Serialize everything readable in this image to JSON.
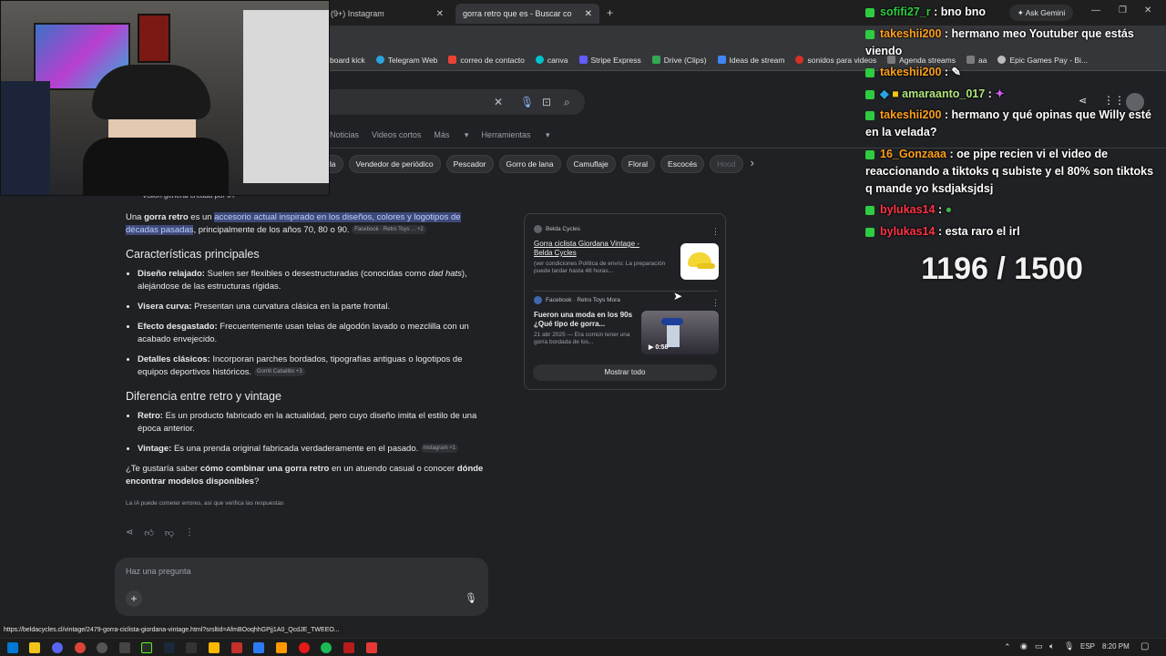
{
  "browser": {
    "tabs": [
      {
        "label": "(9+) Instagram"
      },
      {
        "label": "gorra retro que es - Buscar con"
      }
    ],
    "bookmarks": [
      {
        "label": "board kick",
        "color": "#53fc18"
      },
      {
        "label": "Telegram Web",
        "color": "#2aa3df"
      },
      {
        "label": "correo de contacto",
        "color": "#ea4335"
      },
      {
        "label": "canva",
        "color": "#00c4cc"
      },
      {
        "label": "Stripe Express",
        "color": "#635bff"
      },
      {
        "label": "Drive (Clips)",
        "color": "#34a853"
      },
      {
        "label": "Ideas de stream",
        "color": "#4285f4"
      },
      {
        "label": "sonidos para videos",
        "color": "#d93025"
      },
      {
        "label": "Agenda streams",
        "color": "#7b7b7b"
      },
      {
        "label": "aa",
        "color": "#7b7b7b"
      },
      {
        "label": "Epic Games Pay - Bi...",
        "color": "#bbbbbb"
      }
    ],
    "ask_gemini": "Ask Gemini",
    "status_url": "https://beldacycles.cl/vintage/2479-gorra-ciclista-giordana-vintage.html?srsltid=AfmBOoqhhGPjj1A0_QcdJE_TWEEO..."
  },
  "search": {
    "filters": [
      "Noticias",
      "Videos cortos",
      "Más",
      "Herramientas"
    ],
    "chips": [
      "lla",
      "Vendedor de periódico",
      "Pescador",
      "Gorro de lana",
      "Camuflaje",
      "Floral",
      "Escocés",
      "Hood"
    ],
    "ai_header": "Visión general creada por IA",
    "intro_pre": "Una ",
    "intro_bold": "gorra retro",
    "intro_mid": " es un ",
    "intro_highlight": "accesorio actual inspirado en los diseños, colores y logotipos de décadas pasadas",
    "intro_post": ", principalmente de los años 70, 80 o 90.",
    "intro_source": "Facebook · Retro Toys ...  +2",
    "section1_title": "Características principales",
    "features": [
      {
        "bold": "Diseño relajado:",
        "text": " Suelen ser flexibles o desestructuradas (conocidas como ",
        "italic": "dad hats",
        "text2": "), alejándose de las estructuras rígidas.",
        "source": ""
      },
      {
        "bold": "Visera curva:",
        "text": " Presentan una curvatura clásica en la parte frontal.",
        "italic": "",
        "text2": "",
        "source": ""
      },
      {
        "bold": "Efecto desgastado:",
        "text": " Frecuentemente usan telas de algodón lavado o mezclilla con un acabado envejecido.",
        "italic": "",
        "text2": "",
        "source": ""
      },
      {
        "bold": "Detalles clásicos:",
        "text": " Incorporan parches bordados, tipografías antiguas o logotipos de equipos deportivos históricos.",
        "italic": "",
        "text2": "",
        "source": "Gorriti Caballito +3"
      }
    ],
    "section2_title": "Diferencia entre retro y vintage",
    "differences": [
      {
        "bold": "Retro:",
        "text": " Es un producto fabricado en la actualidad, pero cuyo diseño imita el estilo de una época anterior.",
        "source": ""
      },
      {
        "bold": "Vintage:",
        "text": " Es una prenda original fabricada verdaderamente en el pasado.",
        "source": "Instagram +1"
      }
    ],
    "question_pre": "¿Te gustaría saber ",
    "question_b1": "cómo combinar una gorra retro",
    "question_mid": " en un atuendo casual o conocer ",
    "question_b2": "dónde encontrar modelos disponibles",
    "question_post": "?",
    "disclaimer": "La IA puede cometer errores, así que verifica las respuestas",
    "ask_placeholder": "Haz una pregunta",
    "sources": [
      {
        "site": "Belda Cycles",
        "title": "Gorra ciclista Giordana Vintage - Belda Cycles",
        "desc": "(ver condiciones Política de envío: La preparación puede tardar hasta 48 horas..."
      },
      {
        "site": "Facebook · Retro Toys Mora",
        "title": "Fueron una moda en los 90s ¿Qué tipo de gorra...",
        "desc": "21 abr 2025 — Era común tener una gorra bordada de los...",
        "duration": "0:58"
      }
    ],
    "show_all": "Mostrar todo"
  },
  "chat": {
    "messages": [
      {
        "user": "sofifi27_r",
        "color": "#2ecc40",
        "text": "bno bno"
      },
      {
        "user": "takeshii200",
        "color": "#ff9f1a",
        "text": "hermano meo Youtuber que estás viendo"
      },
      {
        "user": "takeshii200",
        "color": "#ff9f1a",
        "text": ""
      },
      {
        "user": "amaraanto_017",
        "color": "#b0e57c",
        "text": ""
      },
      {
        "user": "takeshii200",
        "color": "#ff9f1a",
        "text": "hermano y qué opinas que Willy esté en la velada?"
      },
      {
        "user": "16_Gonzaaa",
        "color": "#ff9f1a",
        "text": "oe pipe recien vi el video de reaccionando a tiktoks q subiste y el 80% son tiktoks q mande yo ksdjaksjdsj"
      },
      {
        "user": "bylukas14",
        "color": "#ff3344",
        "text": ""
      },
      {
        "user": "bylukas14",
        "color": "#ff3344",
        "text": "esta raro el irl"
      }
    ],
    "counter": "1196 / 1500"
  },
  "taskbar": {
    "lang": "ESP",
    "time": "8:20 PM"
  }
}
